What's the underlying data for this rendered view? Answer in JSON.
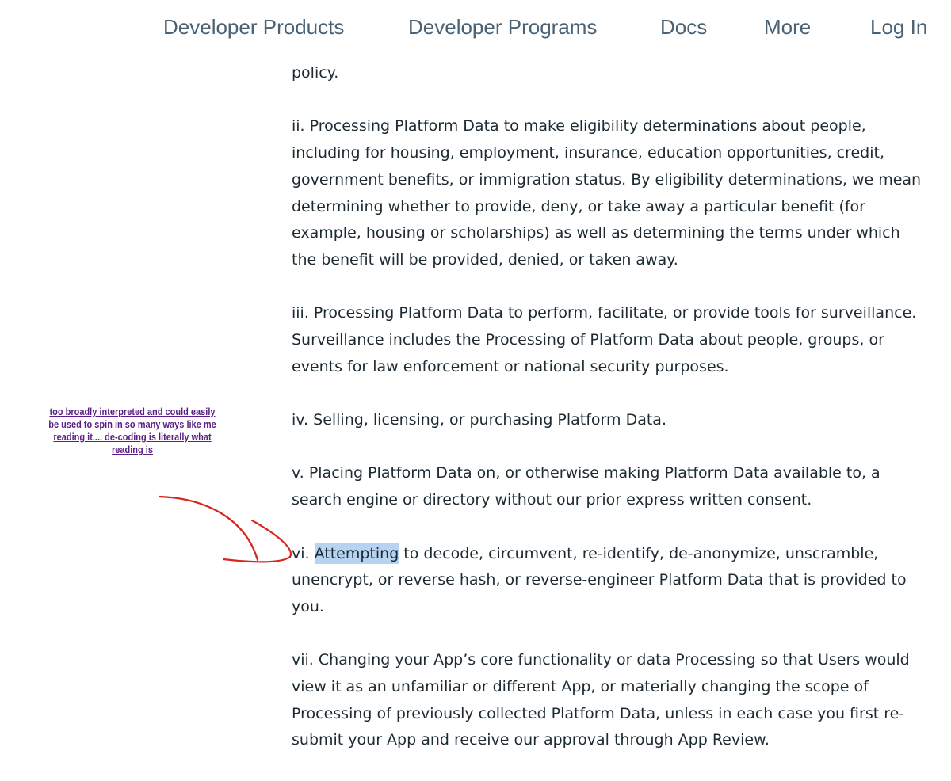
{
  "nav": {
    "items": [
      {
        "label": "Developer Products"
      },
      {
        "label": "Developer Programs"
      },
      {
        "label": "Docs"
      },
      {
        "label": "More"
      },
      {
        "label": "Log In"
      }
    ]
  },
  "content": {
    "p0": "policy.",
    "p1": "ii. Processing Platform Data to make eligibility determinations about people, including for housing, employment, insurance, education opportunities, credit, government benefits, or immigration status. By eligibility determinations, we mean determining whether to provide, deny, or take away a particular benefit (for example, housing or scholarships) as well as determining the terms under which the benefit will be provided, denied, or taken away.",
    "p2": "iii. Processing Platform Data to perform, facilitate, or provide tools for surveillance. Surveillance includes the Processing of Platform Data about people, groups, or events for law enforcement or national security purposes.",
    "p3": "iv. Selling, licensing, or purchasing Platform Data.",
    "p4": "v. Placing Platform Data on, or otherwise making Platform Data available to, a search engine or directory without our prior express written consent.",
    "p5": {
      "prefix": "vi. ",
      "highlighted": "Attempting",
      "suffix": " to decode, circumvent, re-identify, de-anonymize, unscramble, unencrypt, or reverse hash, or reverse-engineer Platform Data that is provided to you."
    },
    "p6": "vii. Changing your App’s core functionality or data Processing so that Users would view it as an unfamiliar or different App, or materially changing the scope of Processing of previously collected Platform Data, unless in each case you first re-submit your App and receive our approval through App Review."
  },
  "annotation": {
    "note": "too broadly interpreted and could easily be used to spin in so many ways like me reading it.... de-coding is literally what reading is",
    "arrow_icon": "hand-drawn-arrow-icon",
    "arrow_color": "#d9261c",
    "note_color": "#5b1d86",
    "highlight_color": "#b7d3f2"
  },
  "colors": {
    "nav_text": "#4a6275",
    "body_text": "#1c2b33",
    "background": "#ffffff"
  }
}
